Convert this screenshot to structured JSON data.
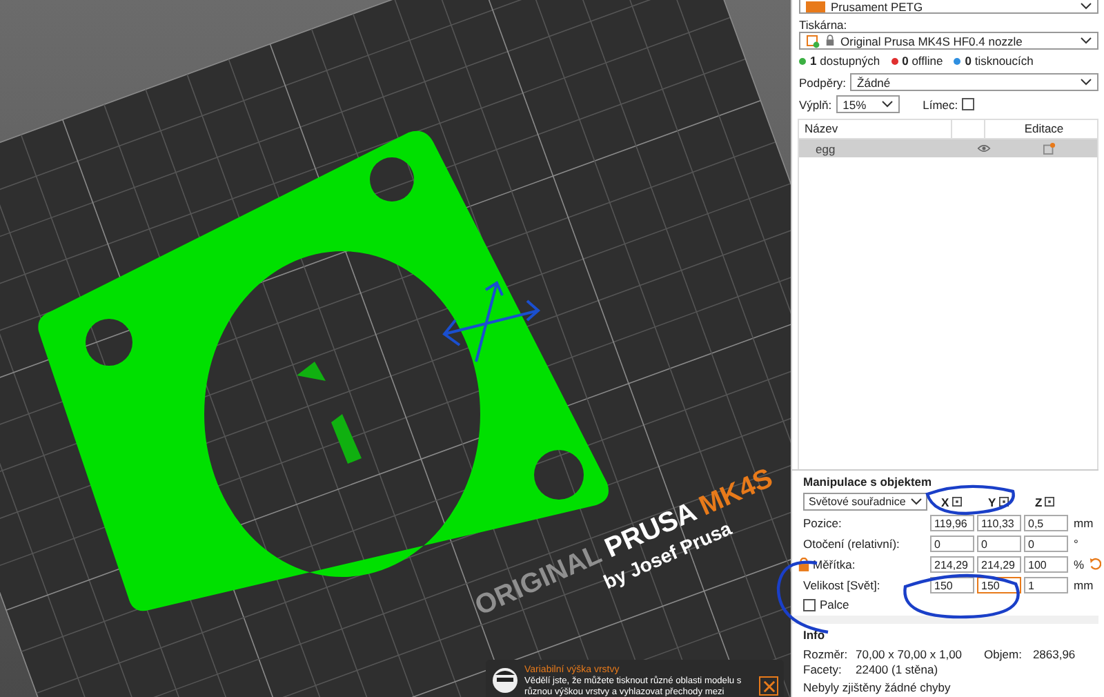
{
  "bed_logo": {
    "brand": "ORIGINAL",
    "maker": "PRUSA",
    "model": "MK4S",
    "tagline": "by Josef Prusa"
  },
  "notification": {
    "title": "Variabilní výška vrstvy",
    "text": "Vědělí jste, že můžete tisknout různé oblasti modelu s různou výškou vrstvy a vyhlazovat přechody mezi"
  },
  "filament": {
    "name": "Prusament PETG"
  },
  "printer": {
    "label": "Tiskárna:",
    "value": "Original Prusa MK4S HF0.4 nozzle"
  },
  "printer_status": [
    {
      "count": "1",
      "label": "dostupných",
      "color": "#3cb043"
    },
    {
      "count": "0",
      "label": "offline",
      "color": "#e03030"
    },
    {
      "count": "0",
      "label": "tisknoucích",
      "color": "#2f8fe0"
    }
  ],
  "supports": {
    "label": "Podpěry:",
    "value": "Žádné"
  },
  "infill": {
    "label": "Výplň:",
    "value": "15%"
  },
  "brim": {
    "label": "Límec:",
    "checked": false
  },
  "object_list": {
    "columns": [
      "Název",
      "Editace"
    ],
    "rows": [
      {
        "name": "egg",
        "selected": true
      }
    ]
  },
  "manipulation": {
    "title": "Manipulace s objektem",
    "coordinate_system": "Světové souřadnice",
    "axes": [
      "X",
      "Y",
      "Z"
    ],
    "rows": [
      {
        "label": "Pozice:",
        "unit": "mm",
        "reset": false,
        "values": [
          {
            "value": "119,96",
            "focused": false
          },
          {
            "value": "110,33",
            "focused": false
          },
          {
            "value": "0,5",
            "focused": false
          }
        ]
      },
      {
        "label": "Otočení (relativní):",
        "unit": "°",
        "reset": false,
        "values": [
          {
            "value": "0",
            "focused": false
          },
          {
            "value": "0",
            "focused": false
          },
          {
            "value": "0",
            "focused": false
          }
        ]
      },
      {
        "label": "Měřítka:",
        "unit": "%",
        "reset": true,
        "values": [
          {
            "value": "214,29",
            "focused": false
          },
          {
            "value": "214,29",
            "focused": false
          },
          {
            "value": "100",
            "focused": false
          }
        ]
      },
      {
        "label": "Velikost [Svět]:",
        "unit": "mm",
        "reset": false,
        "values": [
          {
            "value": "150",
            "focused": false
          },
          {
            "value": "150",
            "focused": true
          },
          {
            "value": "1",
            "focused": false
          }
        ]
      }
    ],
    "inches": {
      "label": "Palce",
      "checked": false
    }
  },
  "info": {
    "title": "Info",
    "size_label": "Rozměr:",
    "size": "70,00 x 70,00 x 1,00",
    "volume_label": "Objem:",
    "volume": "2863,96",
    "facets_label": "Facety:",
    "facets": "22400 (1 stěna)",
    "message": "Nebyly zjištěny žádné chyby"
  }
}
